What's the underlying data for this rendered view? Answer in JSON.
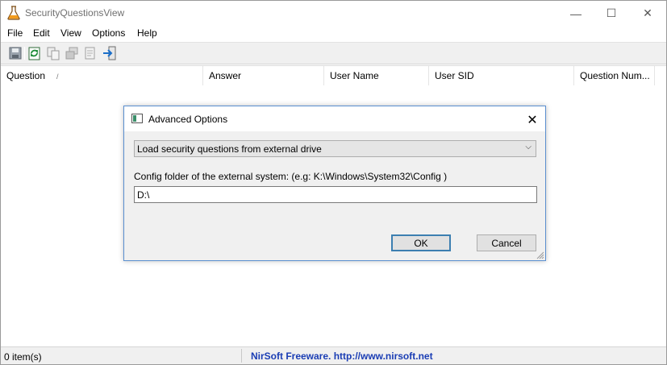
{
  "window": {
    "title": "SecurityQuestionsView",
    "minimize_glyph": "—",
    "maximize_glyph": "☐",
    "close_glyph": "✕"
  },
  "menu": [
    "File",
    "Edit",
    "View",
    "Options",
    "Help"
  ],
  "toolbar": {
    "icons": [
      "save-icon",
      "refresh-icon",
      "copy-icon",
      "properties-icon",
      "report-icon",
      "exit-icon"
    ]
  },
  "list": {
    "columns": [
      "Question",
      "Answer",
      "User Name",
      "User SID",
      "Question Num..."
    ],
    "sort_indicator": "/"
  },
  "status": {
    "count": "0 item(s)",
    "link": "NirSoft Freeware.  http://www.nirsoft.net",
    "link_color": "#1a3db4"
  },
  "dialog": {
    "title": "Advanced Options",
    "close_glyph": "✕",
    "source_select": "Load security questions from external drive",
    "select_arrow": "⌵",
    "config_label": "Config folder of the external system: (e.g: K:\\Windows\\System32\\Config )",
    "config_value": "D:\\",
    "ok_label": "OK",
    "cancel_label": "Cancel",
    "accent_color": "#3c7fb1"
  }
}
